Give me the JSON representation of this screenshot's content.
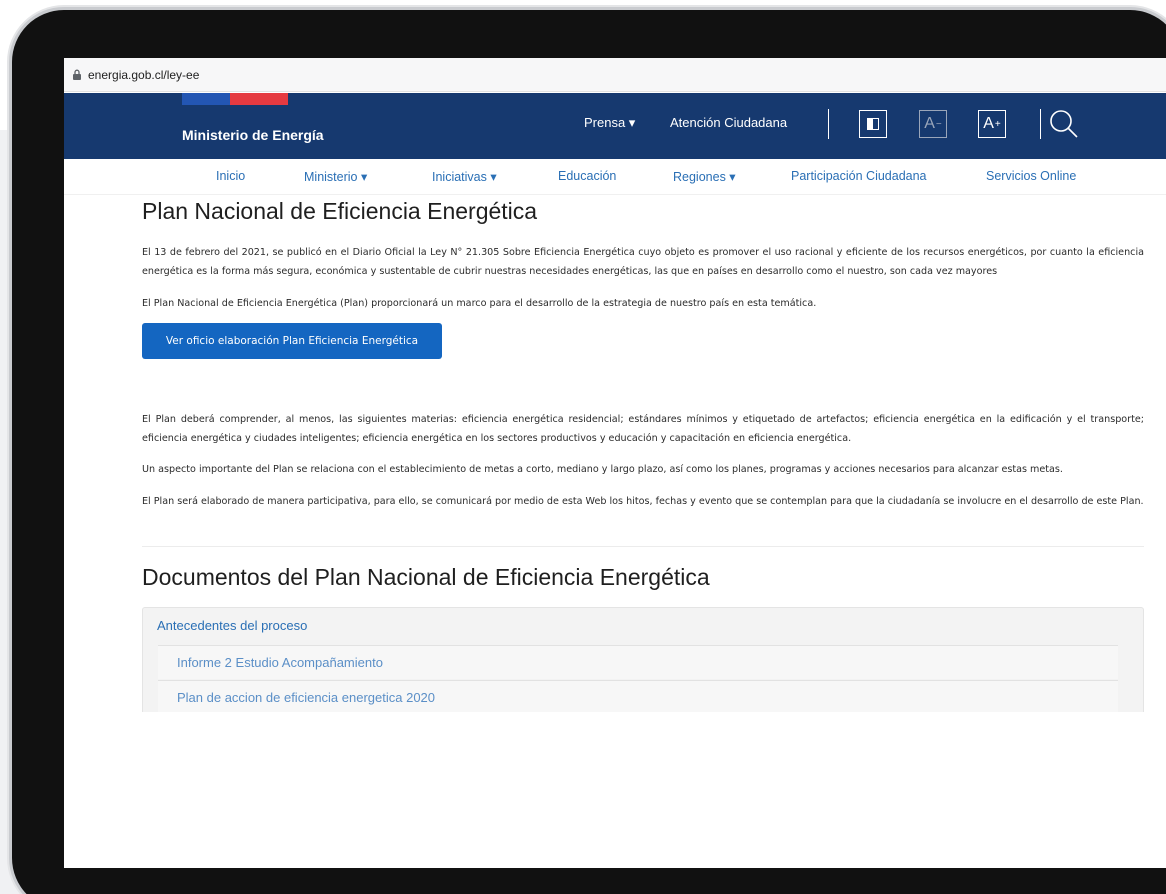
{
  "browser": {
    "url": "energia.gob.cl/ley-ee"
  },
  "header": {
    "logo": "Ministerio de Energía",
    "prensa": "Prensa ▾",
    "atencion": "Atención Ciudadana",
    "tools": {
      "font_decrease": "A",
      "font_increase": "A"
    }
  },
  "nav": {
    "items": [
      {
        "label": "Inicio"
      },
      {
        "label": "Ministerio ▾"
      },
      {
        "label": "Iniciativas ▾"
      },
      {
        "label": "Educación"
      },
      {
        "label": "Regiones ▾"
      },
      {
        "label": "Participación Ciudadana"
      },
      {
        "label": "Servicios Online"
      }
    ]
  },
  "main": {
    "title": "Plan Nacional de Eficiencia Energética",
    "p1": "El 13 de febrero del 2021, se publicó en el Diario Oficial la Ley N° 21.305 Sobre Eficiencia Energética cuyo objeto es promover el uso racional y eficiente de los recursos energéticos, por cuanto la eficiencia energética es la forma más segura, económica y sustentable de cubrir nuestras necesidades energéticas, las que en países en desarrollo como el nuestro, son cada vez mayores",
    "p2": "El Plan Nacional de Eficiencia Energética (Plan) proporcionará un marco para el desarrollo de la estrategia de nuestro país en esta temática.",
    "cta": "Ver oficio elaboración Plan Eficiencia Energética",
    "p3": "El Plan deberá comprender, al menos, las siguientes materias: eficiencia energética residencial; estándares mínimos y etiquetado de artefactos; eficiencia energética en la edificación y el transporte; eficiencia energética y ciudades inteligentes; eficiencia energética en los sectores productivos y educación y capacitación en eficiencia energética.",
    "p4": "Un aspecto importante del Plan se relaciona con el establecimiento de metas a corto, mediano y largo plazo, así como los planes, programas y acciones necesarios para alcanzar estas metas.",
    "p5": "El Plan será elaborado de manera participativa, para ello, se comunicará por medio de esta Web los hitos, fechas y evento que se contemplan para que la ciudadanía se involucre en el desarrollo de este Plan."
  },
  "documents": {
    "title": "Documentos del Plan Nacional de Eficiencia Energética",
    "accordion_header": "Antecedentes del proceso",
    "items": [
      {
        "label": "Informe 2 Estudio Acompañamiento"
      },
      {
        "label": "Plan de accion de eficiencia energetica 2020"
      }
    ]
  },
  "colors": {
    "header_bg": "#16396f",
    "link": "#2a6fb5",
    "button": "#1466c1",
    "flag_blue": "#2356b3",
    "flag_red": "#e53a41"
  }
}
